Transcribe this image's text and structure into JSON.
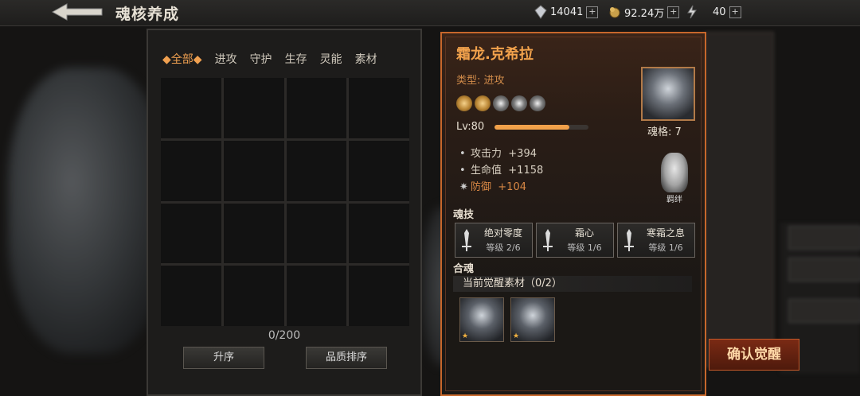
{
  "header": {
    "title": "魂核养成",
    "resources": [
      {
        "icon": "crystal-icon",
        "value": "14041"
      },
      {
        "icon": "gold-icon",
        "value": "92.24万"
      },
      {
        "icon": "stamina-icon",
        "value": "40"
      }
    ],
    "plus": "+"
  },
  "inventory": {
    "tabs": [
      "全部",
      "进攻",
      "守护",
      "生存",
      "灵能",
      "素材"
    ],
    "active_tab": 0,
    "count": "0/200",
    "sort_asc_label": "升序",
    "quality_sort_label": "品质排序"
  },
  "hero": {
    "name": "霜龙.克希拉",
    "type": "类型: 进攻",
    "stars_total": 5,
    "stars_lit": 2,
    "level": "Lv:80",
    "level_progress": 0.8,
    "soul_grade": "魂格:  7",
    "stats": [
      {
        "name": "攻击力",
        "value": "+394",
        "bullet": "•"
      },
      {
        "name": "生命值",
        "value": "+1158",
        "bullet": "•"
      },
      {
        "name": "防御",
        "value": "+104",
        "bullet": "✷"
      }
    ],
    "bond_label": "羁绊",
    "skills_title": "魂技",
    "skills": [
      {
        "name": "绝对零度",
        "level": "等级 2/6"
      },
      {
        "name": "霜心",
        "level": "等级 1/6"
      },
      {
        "name": "寒霜之息",
        "level": "等级 1/6"
      }
    ],
    "fusion_title": "合魂",
    "materials_title": "当前觉醒素材（0/2）",
    "material_count": 2,
    "material_star": "★"
  },
  "actions": {
    "confirm_awaken": "确认觉醒"
  },
  "colors": {
    "accent": "#f0a04a",
    "card_border": "#c7672b"
  }
}
